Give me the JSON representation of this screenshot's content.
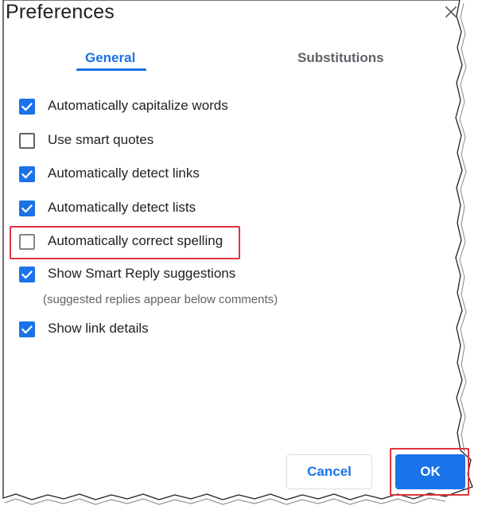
{
  "dialog": {
    "title": "Preferences",
    "close_icon": "close-icon"
  },
  "tabs": [
    {
      "label": "General",
      "selected": true
    },
    {
      "label": "Substitutions",
      "selected": false
    }
  ],
  "options": [
    {
      "label": "Automatically capitalize words",
      "checked": true
    },
    {
      "label": "Use smart quotes",
      "checked": false
    },
    {
      "label": "Automatically detect links",
      "checked": true
    },
    {
      "label": "Automatically detect lists",
      "checked": true
    },
    {
      "label": "Automatically correct spelling",
      "checked": false,
      "highlighted": true
    },
    {
      "label": "Show Smart Reply suggestions",
      "checked": true,
      "hint": "(suggested replies appear below comments)"
    },
    {
      "label": "Show link details",
      "checked": true
    }
  ],
  "buttons": {
    "cancel": "Cancel",
    "ok": "OK"
  },
  "colors": {
    "accent": "#1a73e8",
    "highlight": "#e0343f",
    "text": "#202124",
    "muted": "#5f6368"
  }
}
